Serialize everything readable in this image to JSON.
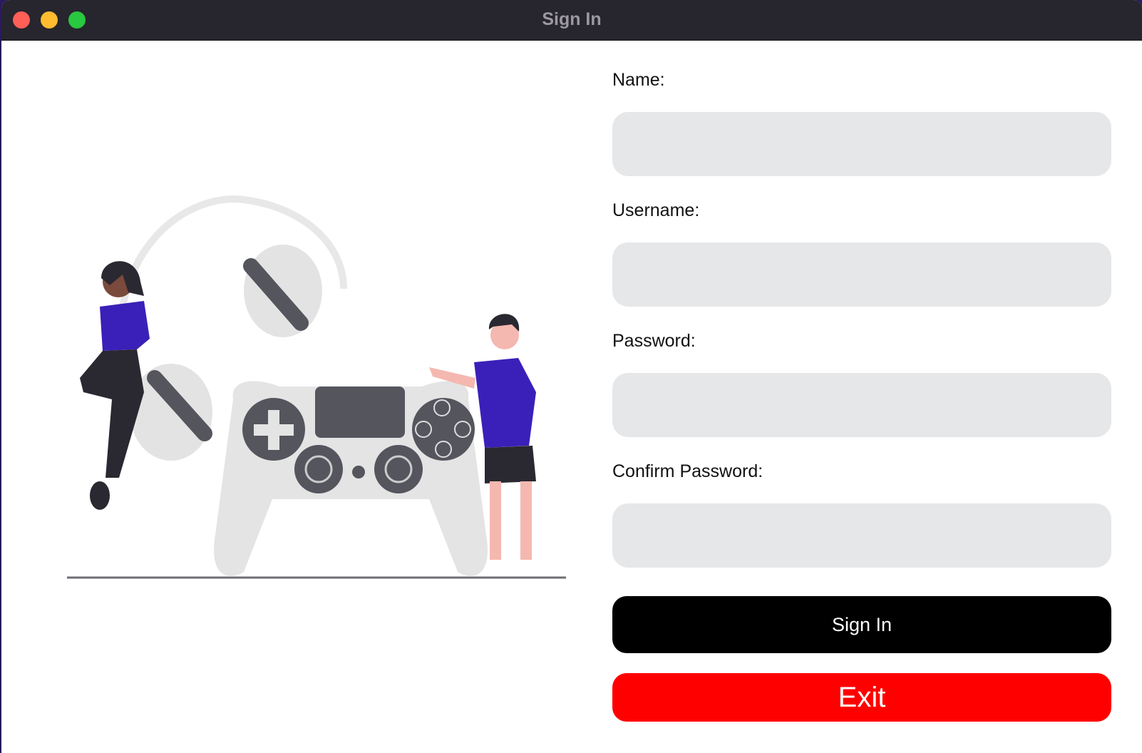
{
  "window": {
    "title": "Sign In",
    "controls": [
      "close",
      "minimize",
      "maximize"
    ]
  },
  "illustration": {
    "icon": "gamers-controller-illustration"
  },
  "form": {
    "fields": [
      {
        "label": "Name:",
        "value": "",
        "placeholder": ""
      },
      {
        "label": "Username:",
        "value": "",
        "placeholder": ""
      },
      {
        "label": "Password:",
        "value": "",
        "placeholder": ""
      },
      {
        "label": "Confirm Password:",
        "value": "",
        "placeholder": ""
      }
    ],
    "signin_label": "Sign In",
    "exit_label": "Exit"
  },
  "colors": {
    "titlebar": "#27252d",
    "field_bg": "#e6e7e9",
    "signin_button": "#000000",
    "exit_button": "#ff0000",
    "accent_shirt": "#3a20b8"
  }
}
